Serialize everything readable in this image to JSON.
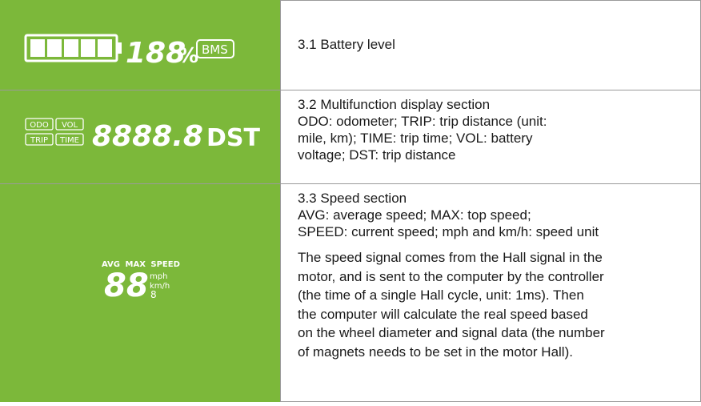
{
  "rows": [
    {
      "display": {
        "percent_digits": "188",
        "percent_sign": "%",
        "bms": "BMS"
      },
      "text": [
        "3.1 Battery level"
      ]
    },
    {
      "display": {
        "labels": [
          "ODO",
          "VOL",
          "TRIP",
          "TIME"
        ],
        "digits": "8888.8",
        "unit": "DST"
      },
      "text": [
        "3.2 Multifunction display section",
        "ODO: odometer; TRIP: trip distance (unit:",
        "mile, km); TIME: trip time; VOL: battery",
        "voltage; DST: trip distance"
      ]
    },
    {
      "display": {
        "header_avg": "AVG",
        "header_max": "MAX",
        "header_speed": "SPEED",
        "digits": "88",
        "unit_mph": "mph",
        "unit_kmh": "km/h",
        "small_digit": "8"
      },
      "text": [
        "3.3 Speed section",
        "AVG: average speed; MAX: top speed;",
        "SPEED: current speed; mph and km/h: speed unit"
      ],
      "paragraph": [
        "The speed signal comes from the Hall signal in the",
        "motor, and is sent to the computer by the controller",
        "(the time of a single Hall cycle, unit: 1ms). Then",
        "the computer will calculate the real speed based",
        "on the wheel diameter and signal data (the number",
        "of magnets needs to be set in the motor Hall)."
      ]
    }
  ],
  "colors": {
    "lcd_green": "#7cb83a",
    "border": "#9a9a9a",
    "text": "#1a1a1a"
  }
}
